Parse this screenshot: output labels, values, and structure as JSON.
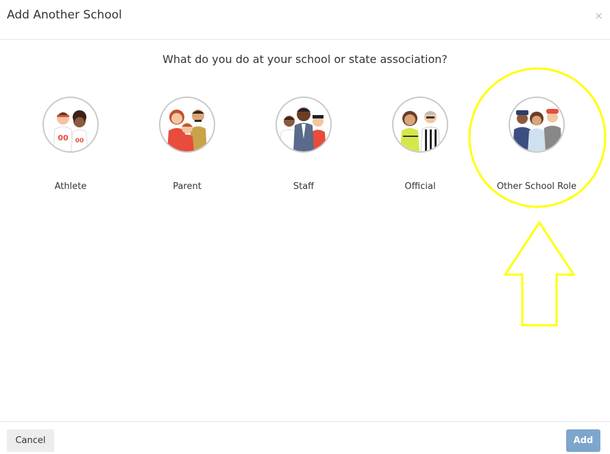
{
  "modal": {
    "title": "Add Another School",
    "close_glyph": "×",
    "question": "What do you do at your school or state association?"
  },
  "roles": [
    {
      "label": "Athlete",
      "icon": "athlete-avatar"
    },
    {
      "label": "Parent",
      "icon": "parent-avatar"
    },
    {
      "label": "Staff",
      "icon": "staff-avatar"
    },
    {
      "label": "Official",
      "icon": "official-avatar"
    },
    {
      "label": "Other School Role",
      "icon": "other-school-role-avatar"
    }
  ],
  "footer": {
    "cancel_label": "Cancel",
    "add_label": "Add"
  },
  "annotation": {
    "highlight_color": "#ffff00",
    "shapes": [
      "circle-highlight",
      "up-arrow"
    ]
  }
}
